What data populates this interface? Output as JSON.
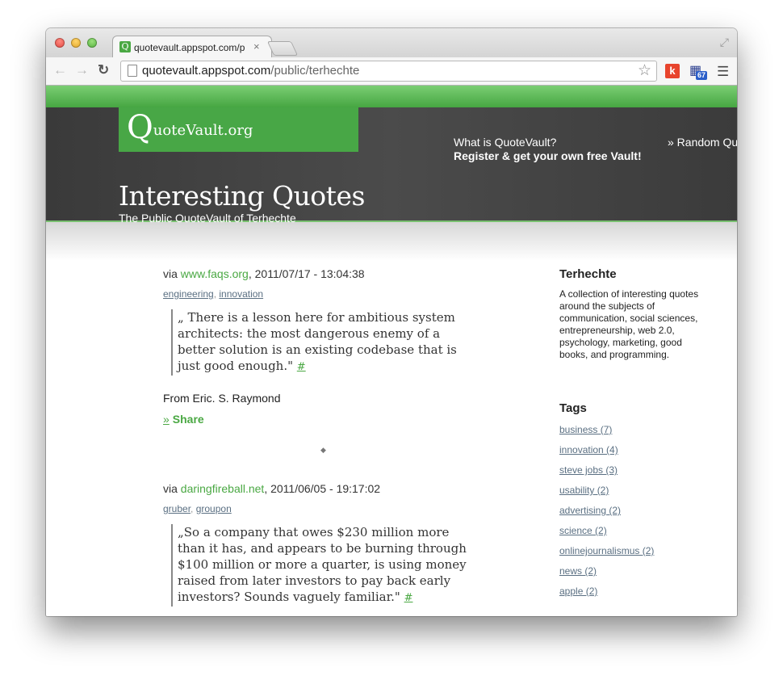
{
  "browser": {
    "tab_title": "quotevault.appspot.com/p",
    "tab_close": "×",
    "url_domain": "quotevault.appspot.com",
    "url_path": "/public/terhechte",
    "ext_badge": "67",
    "icons": {
      "back": "back-arrow-icon",
      "forward": "forward-arrow-icon",
      "reload": "reload-icon",
      "star": "bookmark-star-icon",
      "menu": "menu-icon"
    }
  },
  "site": {
    "logo_q": "Q",
    "logo_rest": "uoteVault.org",
    "nav_what": "What is QuoteVault?",
    "nav_register": "Register & get your own free Vault!",
    "nav_random": "» Random Qu",
    "page_title": "Interesting Quotes",
    "page_subtitle": "The Public QuoteVault of Terhechte",
    "colors": {
      "accent_green": "#4aa843",
      "header_dark": "#444444",
      "tag_link": "#5a6f82"
    }
  },
  "quotes": [
    {
      "via_prefix": "via ",
      "source": "www.faqs.org",
      "datetime": ", 2011/07/17 - 13:04:38",
      "tags": [
        "engineering",
        "innovation"
      ],
      "text": "„ There is a lesson here for ambitious system architects: the most dangerous enemy of a better solution is an existing codebase that is just good enough.\"",
      "permalink": "#",
      "author": "From Eric. S. Raymond",
      "share_prefix": "»",
      "share_label": "Share"
    },
    {
      "via_prefix": "via ",
      "source": "daringfireball.net",
      "datetime": ", 2011/06/05 - 19:17:02",
      "tags": [
        "gruber",
        "groupon"
      ],
      "text": "„So a company that owes $230 million more than it has, and appears to be burning through $100 million or more a quarter, is using money raised from later investors to pay back early investors? Sounds vaguely familiar.\"",
      "permalink": "#"
    }
  ],
  "divider": "◆",
  "sidebar": {
    "title": "Terhechte",
    "description": "A collection of interesting quotes around the subjects of communication, social sciences, entrepreneurship, web 2.0, psychology, marketing, good books, and programming.",
    "tags_title": "Tags",
    "tags": [
      "business (7)",
      "innovation (4)",
      "steve jobs (3)",
      "usability (2)",
      "advertising (2)",
      "science (2)",
      "onlinejournalismus (2)",
      "news (2)",
      "apple (2)"
    ]
  }
}
